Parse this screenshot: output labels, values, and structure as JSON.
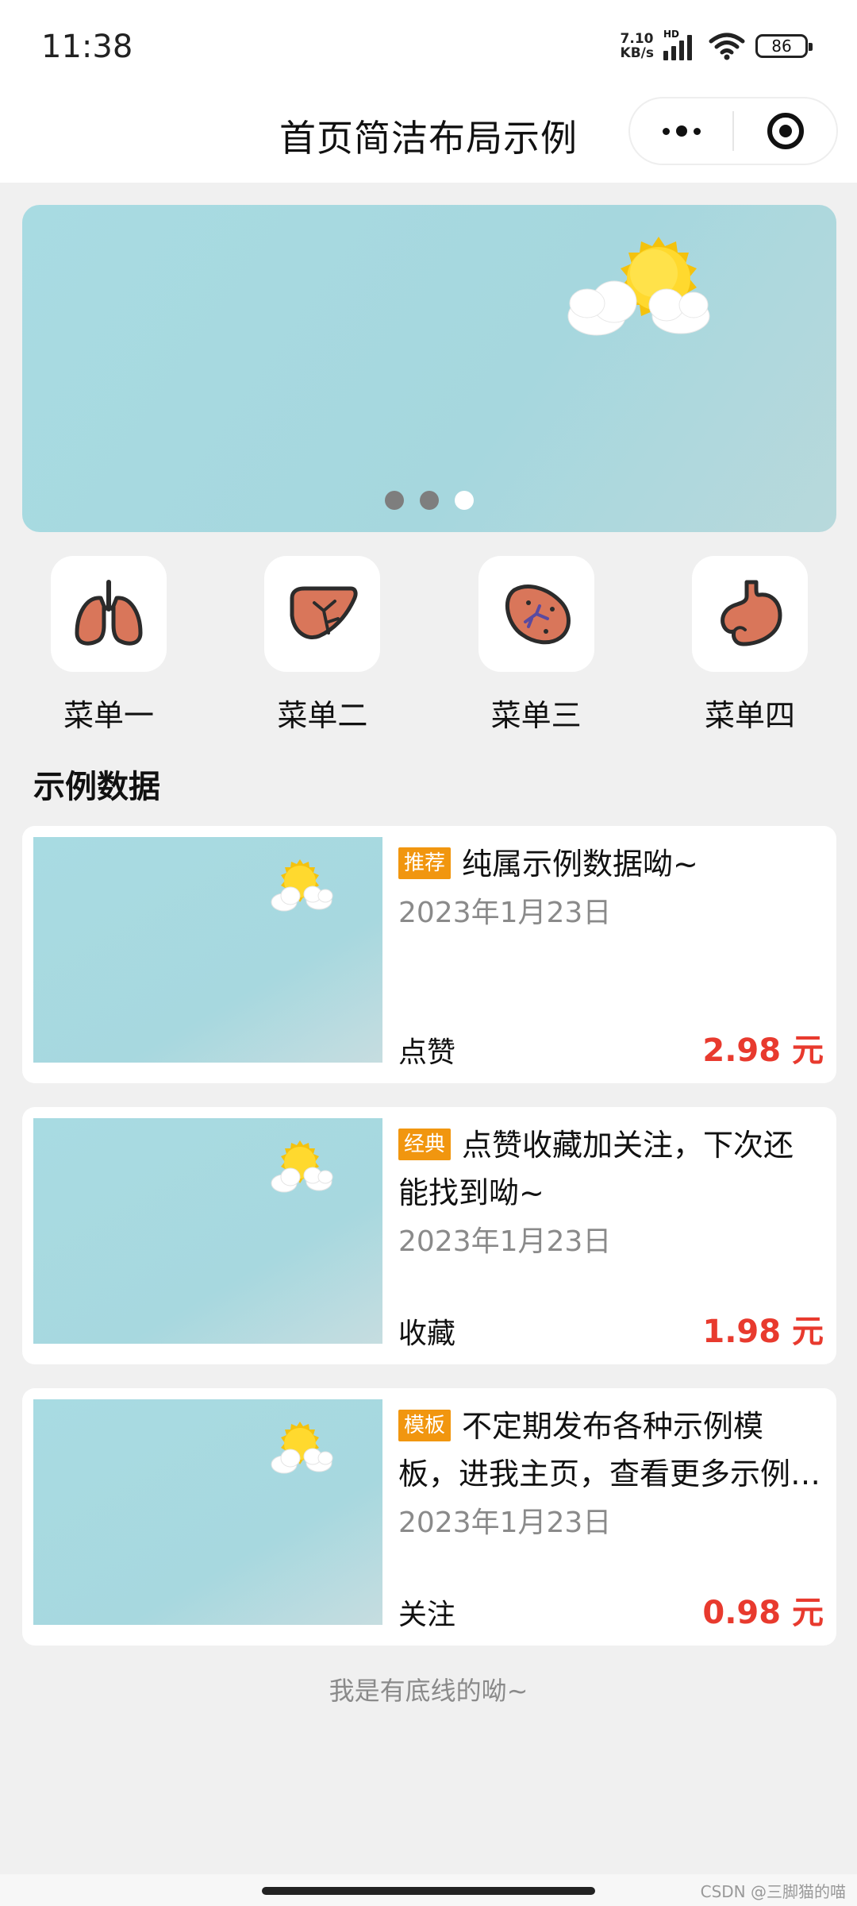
{
  "status": {
    "time": "11:38",
    "net_speed_value": "7.10",
    "net_speed_unit": "KB/s",
    "hd": "HD",
    "battery": "86"
  },
  "nav": {
    "title": "首页简洁布局示例"
  },
  "banner": {
    "dot_count": 3,
    "active_dot": 3
  },
  "menu": [
    {
      "label": "菜单一",
      "icon": "lungs-icon"
    },
    {
      "label": "菜单二",
      "icon": "liver-icon"
    },
    {
      "label": "菜单三",
      "icon": "kidney-icon"
    },
    {
      "label": "菜单四",
      "icon": "stomach-icon"
    }
  ],
  "section": {
    "title": "示例数据"
  },
  "items": [
    {
      "tag": "推荐",
      "title": "纯属示例数据呦~",
      "date": "2023年1月23日",
      "action": "点赞",
      "price": "2.98 元"
    },
    {
      "tag": "经典",
      "title": "点赞收藏加关注，下次还能找到呦~",
      "date": "2023年1月23日",
      "action": "收藏",
      "price": "1.98 元"
    },
    {
      "tag": "模板",
      "title": "不定期发布各种示例模板，进我主页，查看更多示例呦~",
      "date": "2023年1月23日",
      "action": "关注",
      "price": "0.98 元"
    }
  ],
  "footer": {
    "note": "我是有底线的呦~"
  },
  "watermark": "CSDN @三脚猫的喵",
  "colors": {
    "tag_bg": "#f1960f",
    "price": "#e83a2e",
    "banner_bg": "#a8dbe2",
    "organ_fill": "#d9765a"
  }
}
